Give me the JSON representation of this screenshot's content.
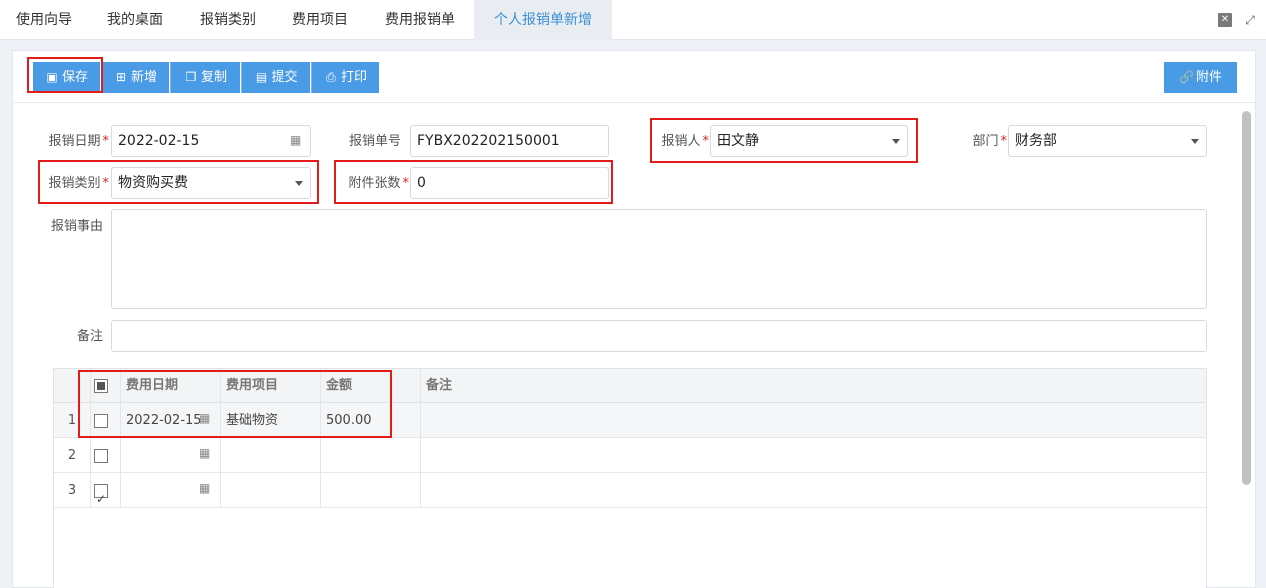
{
  "tabs": [
    {
      "label": "使用向导"
    },
    {
      "label": "我的桌面"
    },
    {
      "label": "报销类别"
    },
    {
      "label": "费用项目"
    },
    {
      "label": "费用报销单"
    },
    {
      "label": "个人报销单新增",
      "active": true
    }
  ],
  "toolbar": {
    "save": "保存",
    "new": "新增",
    "copy": "复制",
    "submit": "提交",
    "print": "打印",
    "attach": "附件"
  },
  "form": {
    "date_label": "报销日期",
    "date_value": "2022-02-15",
    "number_label": "报销单号",
    "number_value": "FYBX202202150001",
    "person_label": "报销人",
    "person_value": "田文静",
    "dept_label": "部门",
    "dept_value": "财务部",
    "category_label": "报销类别",
    "category_value": "物资购买费",
    "attach_count_label": "附件张数",
    "attach_count_value": "0",
    "reason_label": "报销事由",
    "reason_value": "",
    "remark_label": "备注",
    "remark_value": "",
    "required_mark": "*"
  },
  "grid": {
    "columns": [
      "费用日期",
      "费用项目",
      "金额",
      "备注"
    ],
    "rows": [
      {
        "num": "1",
        "date": "2022-02-15",
        "item": "基础物资",
        "amount": "500.00",
        "remark": "",
        "checked": false
      },
      {
        "num": "2",
        "date": "",
        "item": "",
        "amount": "",
        "remark": "",
        "checked": false
      },
      {
        "num": "3",
        "date": "",
        "item": "",
        "amount": "",
        "remark": "",
        "checked": true
      }
    ]
  },
  "colors": {
    "accent": "#4a9be6",
    "active_tab_text": "#3b8fd6",
    "highlight": "#e31b1b",
    "required": "#e02020"
  },
  "icons": {
    "save": "floppy-icon",
    "new": "plus-square-icon",
    "copy": "copy-icon",
    "submit": "document-icon",
    "print": "printer-icon",
    "attach": "link-icon",
    "date": "calendar-icon",
    "select": "caret-down-icon"
  }
}
